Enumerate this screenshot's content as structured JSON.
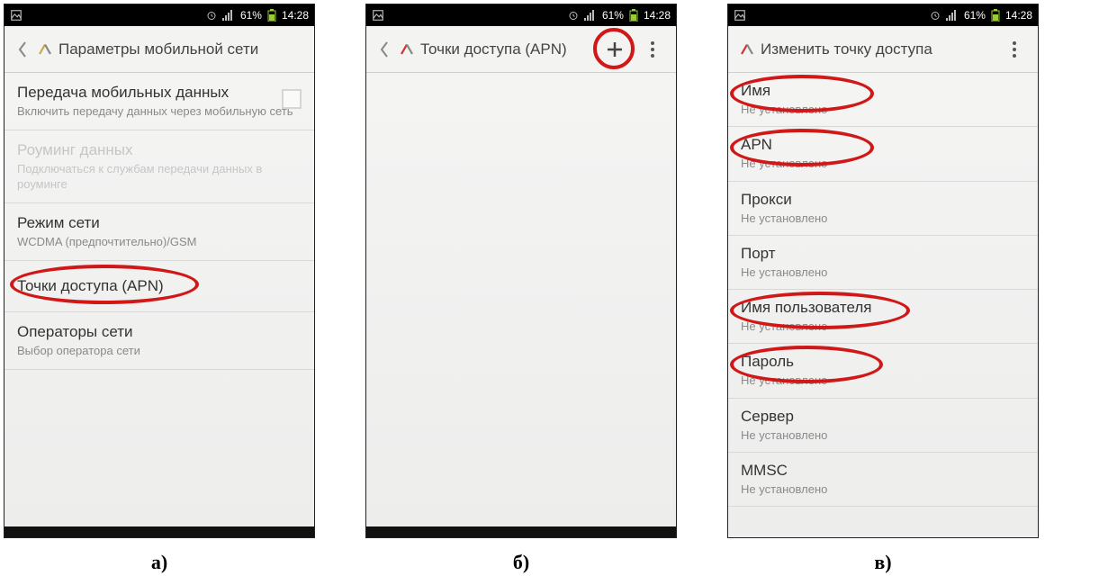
{
  "status": {
    "battery_pct": "61%",
    "time": "14:28"
  },
  "screens": {
    "a": {
      "title": "Параметры мобильной сети",
      "rows": [
        {
          "title": "Передача мобильных данных",
          "sub": "Включить передачу данных через мобильную сеть",
          "checkbox": true
        },
        {
          "title": "Роуминг данных",
          "sub": "Подключаться к службам передачи данных в роуминге",
          "disabled": true
        },
        {
          "title": "Режим сети",
          "sub": "WCDMA (предпочтительно)/GSM"
        },
        {
          "title": "Точки доступа (APN)",
          "ring": true
        },
        {
          "title": "Операторы сети",
          "sub": "Выбор оператора сети"
        }
      ],
      "caption": "а)"
    },
    "b": {
      "title": "Точки доступа (APN)",
      "add_ring": true,
      "caption": "б)"
    },
    "c": {
      "title": "Изменить точку доступа",
      "not_set": "Не установлено",
      "rows": [
        {
          "title": "Имя",
          "ring": true
        },
        {
          "title": "APN",
          "ring": true
        },
        {
          "title": "Прокси"
        },
        {
          "title": "Порт"
        },
        {
          "title": "Имя пользователя",
          "ring": true
        },
        {
          "title": "Пароль",
          "ring": true
        },
        {
          "title": "Сервер"
        },
        {
          "title": "MMSC"
        }
      ],
      "caption": "в)"
    }
  }
}
